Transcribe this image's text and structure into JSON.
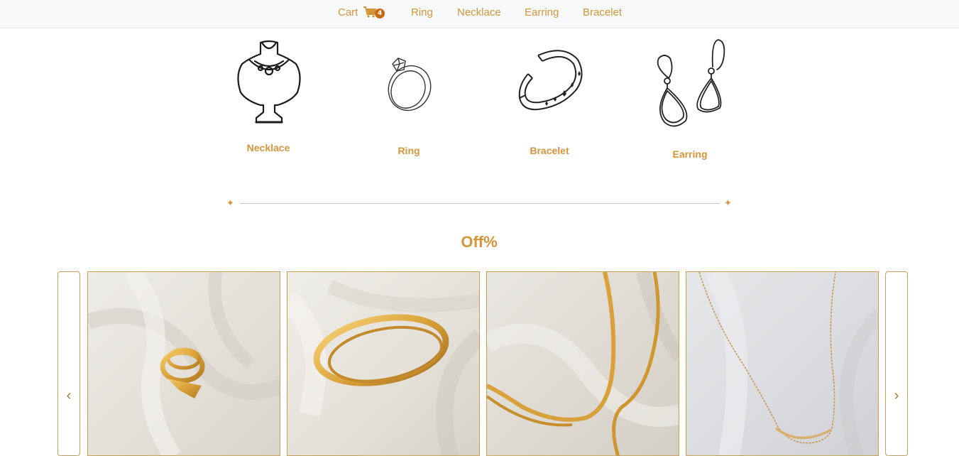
{
  "nav": {
    "cart_label": "Cart",
    "cart_count": "4",
    "links": [
      "Ring",
      "Necklace",
      "Earring",
      "Bracelet"
    ]
  },
  "categories": [
    "Necklace",
    "Ring",
    "Bracelet",
    "Earring"
  ],
  "divider_glyph": "✦",
  "section": {
    "title": "Off%"
  },
  "carousel": {
    "prev_glyph": "‹",
    "next_glyph": "›",
    "products": [
      "gold-ring-photo",
      "gold-cuff-bracelet-photo",
      "gold-snake-chain-necklace-photo",
      "gold-fine-chain-necklace-photo"
    ]
  },
  "colors": {
    "accent": "#d4953a",
    "badge": "#c96a12",
    "border": "#c9a050"
  }
}
